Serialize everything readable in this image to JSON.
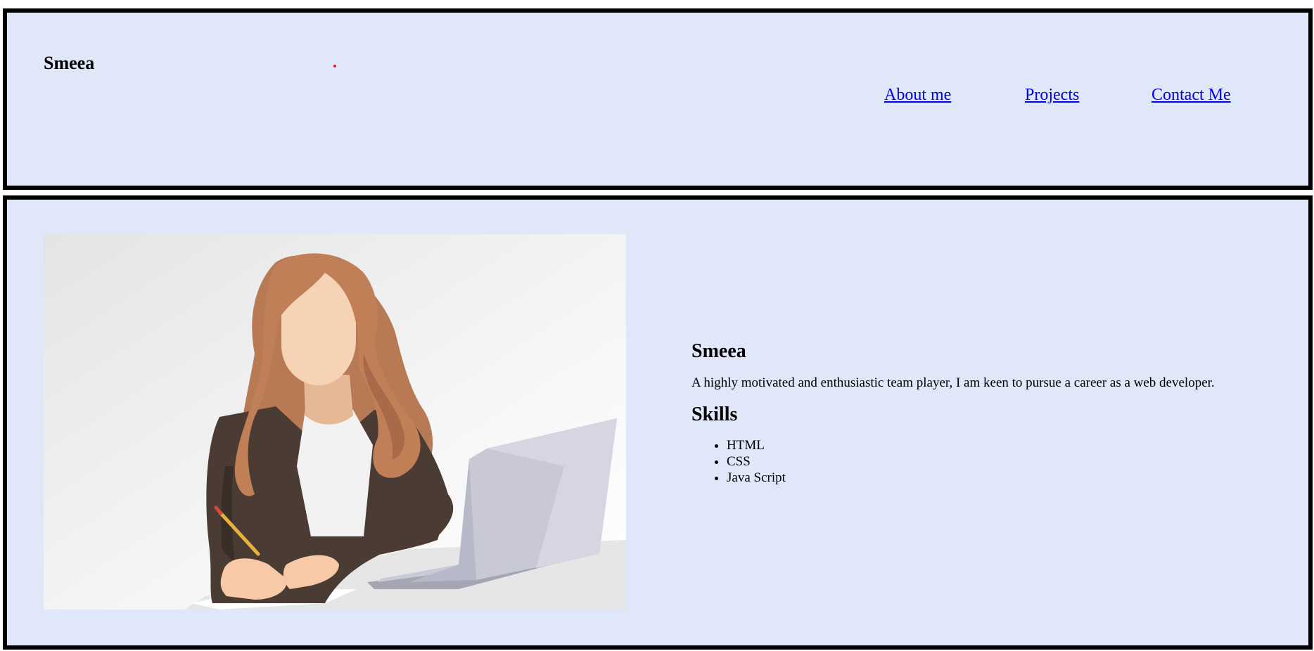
{
  "header": {
    "brand": "Smeea",
    "nav": [
      {
        "label": "About me"
      },
      {
        "label": "Projects"
      },
      {
        "label": "Contact Me"
      }
    ]
  },
  "hero": {
    "illustration": "woman-at-desk-with-laptop-illustration"
  },
  "about": {
    "name": "Smeea",
    "bio": "A highly motivated and enthusiastic team player, I am keen to pursue a career as a web developer.",
    "skills_title": "Skills",
    "skills": [
      "HTML",
      "CSS",
      "Java Script"
    ]
  },
  "colors": {
    "panel_bg": "#dfe7f9",
    "border": "#000000",
    "link": "#0000ee",
    "accent_dot": "#e0192a"
  }
}
